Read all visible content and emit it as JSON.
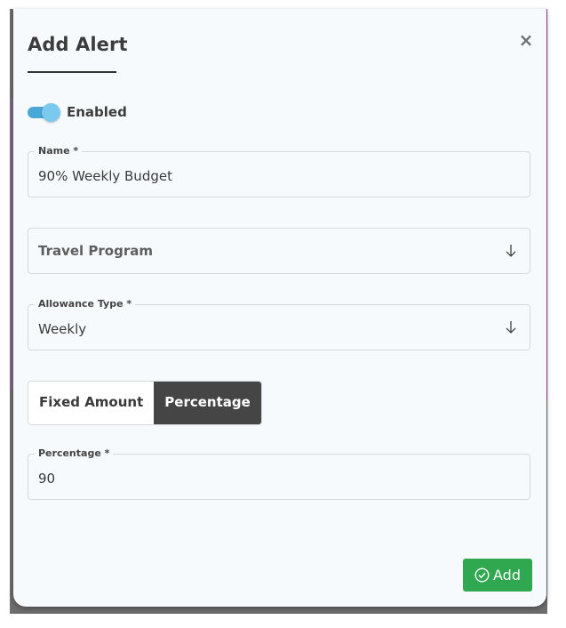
{
  "dialog": {
    "title": "Add Alert",
    "close_symbol": "×"
  },
  "enabled_toggle": {
    "label": "Enabled",
    "checked": true,
    "color": "#4aa8d8"
  },
  "name_field": {
    "label": "Name *",
    "value": "90% Weekly Budget"
  },
  "travel_program_select": {
    "placeholder": "Travel Program",
    "icon": "arrow-down-icon"
  },
  "allowance_type_select": {
    "label": "Allowance Type *",
    "value": "Weekly",
    "icon": "arrow-down-icon"
  },
  "amount_mode": {
    "options": [
      "Fixed Amount",
      "Percentage"
    ],
    "selected": "Percentage"
  },
  "percentage_field": {
    "label": "Percentage *",
    "value": "90"
  },
  "add_button": {
    "label": "Add",
    "icon": "check-circle-icon",
    "color": "#2fa84f"
  }
}
